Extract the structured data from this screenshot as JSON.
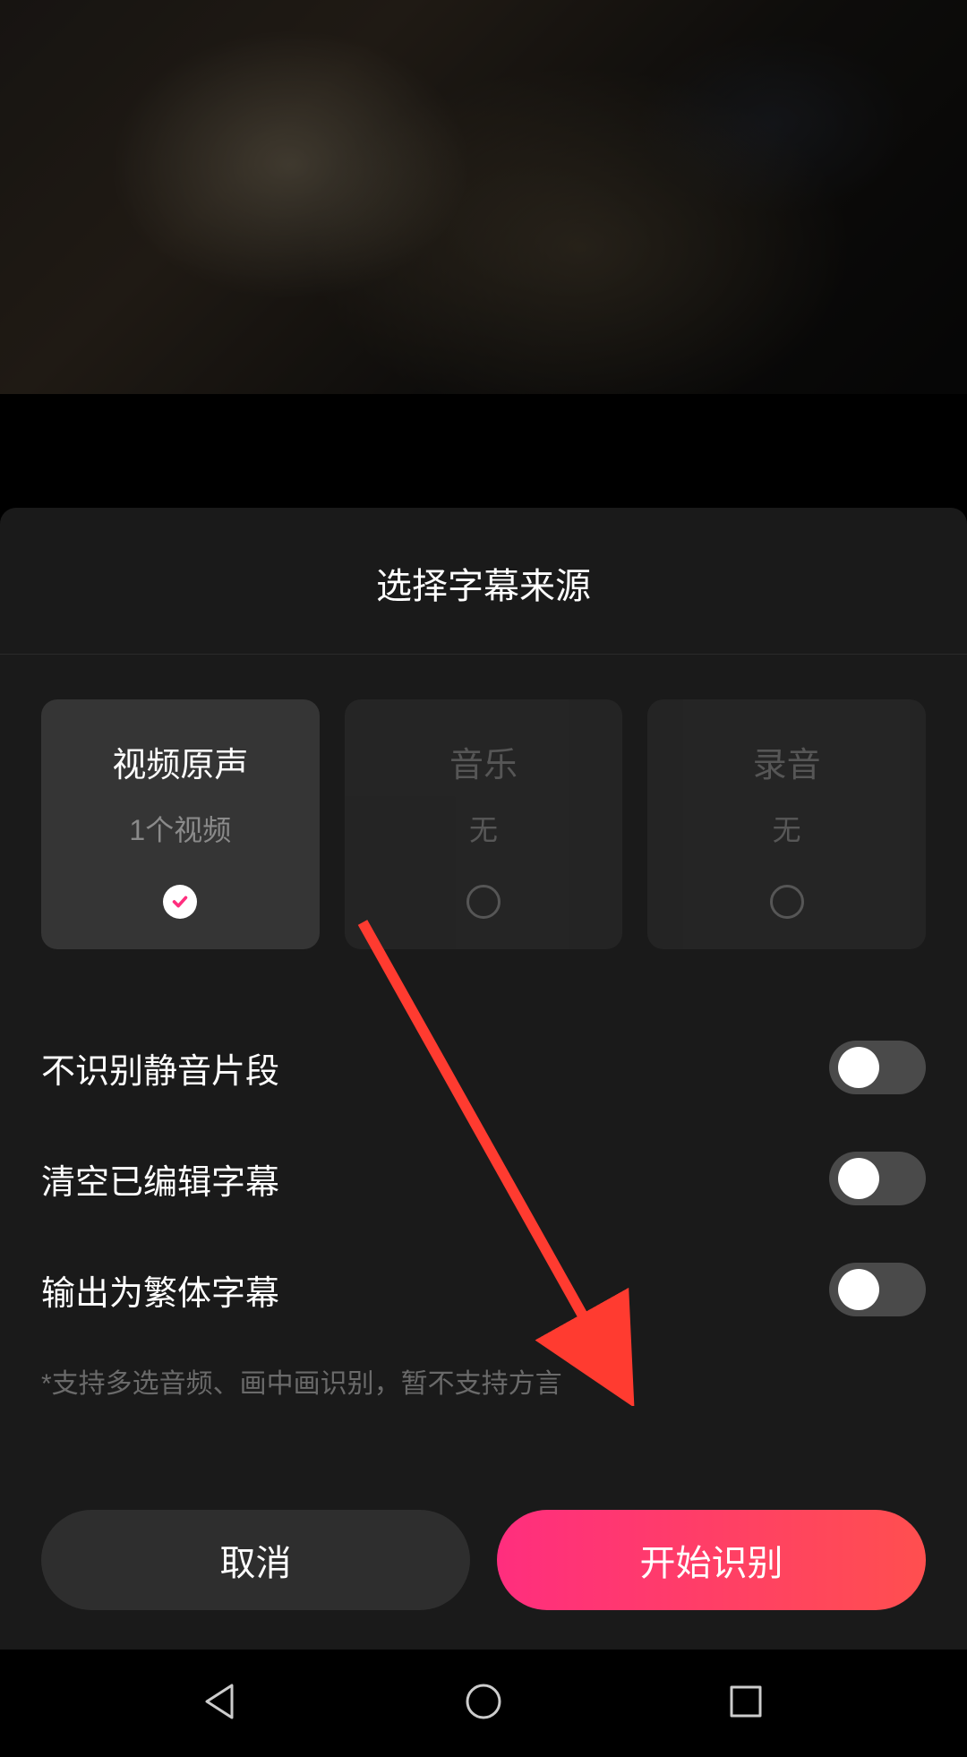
{
  "sheet": {
    "title": "选择字幕来源",
    "sources": [
      {
        "title": "视频原声",
        "subtitle": "1个视频",
        "selected": true,
        "enabled": true
      },
      {
        "title": "音乐",
        "subtitle": "无",
        "selected": false,
        "enabled": false
      },
      {
        "title": "录音",
        "subtitle": "无",
        "selected": false,
        "enabled": false
      }
    ],
    "options": [
      {
        "label": "不识别静音片段",
        "on": false
      },
      {
        "label": "清空已编辑字幕",
        "on": false
      },
      {
        "label": "输出为繁体字幕",
        "on": false
      }
    ],
    "hint": "*支持多选音频、画中画识别，暂不支持方言",
    "buttons": {
      "cancel": "取消",
      "start": "开始识别"
    }
  },
  "colors": {
    "accent": "#ff2e7e",
    "arrow": "#ff3b30"
  }
}
